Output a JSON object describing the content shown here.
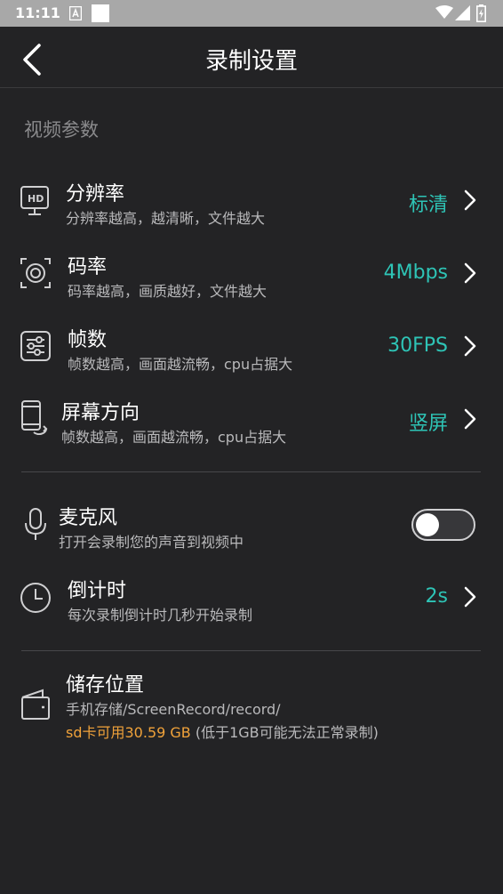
{
  "status_bar": {
    "time": "11:11"
  },
  "app_bar": {
    "title": "录制设置"
  },
  "section": {
    "video_params": "视频参数"
  },
  "settings": {
    "resolution": {
      "label": "分辨率",
      "subtitle": "分辨率越高，越清晰，文件越大",
      "value": "标清"
    },
    "bitrate": {
      "label": "码率",
      "subtitle": "码率越高，画质越好，文件越大",
      "value": "4Mbps"
    },
    "framerate": {
      "label": "帧数",
      "subtitle": "帧数越高，画面越流畅，cpu占据大",
      "value": "30FPS"
    },
    "orientation": {
      "label": "屏幕方向",
      "subtitle": "帧数越高，画面越流畅，cpu占据大",
      "value": "竖屏"
    },
    "microphone": {
      "label": "麦克风",
      "subtitle": "打开会录制您的声音到视频中",
      "enabled": false
    },
    "countdown": {
      "label": "倒计时",
      "subtitle": "每次录制倒计时几秒开始录制",
      "value": "2s"
    },
    "storage": {
      "label": "储存位置",
      "path": "手机存储/ScreenRecord/record/",
      "available": "sd卡可用30.59 GB",
      "warning": " (低于1GB可能无法正常录制)"
    }
  },
  "colors": {
    "accent": "#2ec4b6",
    "warning": "#f0a23a",
    "background": "#232325"
  }
}
